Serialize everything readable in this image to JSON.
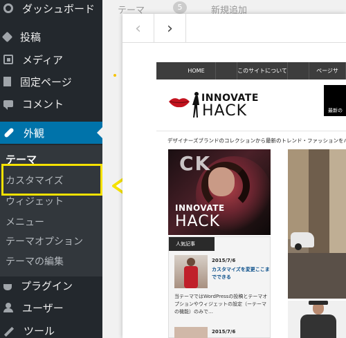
{
  "sidebar": {
    "items": [
      {
        "label": "ダッシュボード",
        "icon": "dashboard-icon"
      },
      {
        "label": "投稿",
        "icon": "pin-icon"
      },
      {
        "label": "メディア",
        "icon": "media-icon"
      },
      {
        "label": "固定ページ",
        "icon": "pages-icon"
      },
      {
        "label": "コメント",
        "icon": "comments-icon"
      },
      {
        "label": "外観",
        "icon": "appearance-icon"
      },
      {
        "label": "プラグイン",
        "icon": "plugins-icon"
      },
      {
        "label": "ユーザー",
        "icon": "users-icon"
      },
      {
        "label": "ツール",
        "icon": "tools-icon"
      }
    ],
    "submenu": {
      "heading": "テーマ",
      "items": [
        "カスタマイズ",
        "ウィジェット",
        "メニュー",
        "テーマオプション",
        "テーマの編集"
      ]
    }
  },
  "background": {
    "tab1": "テーマ",
    "badge": "5",
    "tab2": "新規追加"
  },
  "preview": {
    "prev_glyph": "‹",
    "next_glyph": "›",
    "site": {
      "nav": [
        "HOME",
        "このサイトについて",
        "ページサ"
      ],
      "logo_line1": "INNOVATE",
      "logo_line2": "HACK",
      "banner_text": "最新の",
      "tagline": "デザイナーズブランドのコレクションから最新のトレンド・ファッションをハッキング",
      "hero_overlay": "CK",
      "hero_title1": "INNOVATE",
      "hero_title2": "HACK",
      "popular_label": "人気記事",
      "popular_date": "2015/7/6",
      "popular_title": "カスタマイズを変更ここまでできる",
      "popular_excerpt": "当テーマではWordPressの投稿とテーマオプションやウィジェットの設定（ーテーマの機能）のみで…",
      "popular_date2": "2015/7/6"
    }
  },
  "colors": {
    "sidebar_bg": "#23282d",
    "submenu_bg": "#32373c",
    "current_item": "#0073aa",
    "highlight": "#f6e200"
  }
}
